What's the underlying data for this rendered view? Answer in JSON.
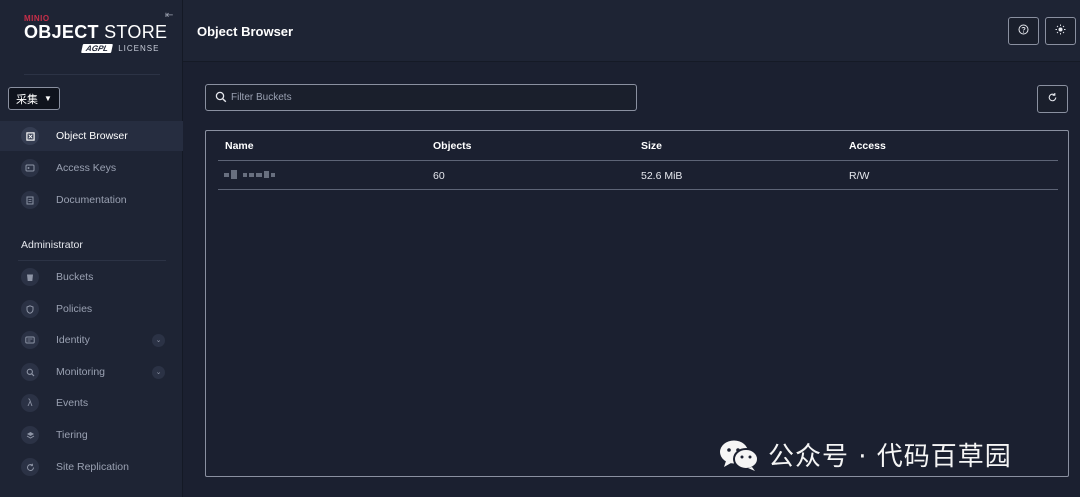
{
  "logo": {
    "brand": "MINIO",
    "title_bold": "OBJECT",
    "title_light": " STORE",
    "badge": "AGPL",
    "license": "LICENSE"
  },
  "workspace_select": {
    "value": "采集"
  },
  "sidebar": {
    "user_items": [
      {
        "label": "Object Browser",
        "icon": "object-browser-icon",
        "active": true
      },
      {
        "label": "Access Keys",
        "icon": "key-icon",
        "active": false
      },
      {
        "label": "Documentation",
        "icon": "document-icon",
        "active": false
      }
    ],
    "admin_title": "Administrator",
    "admin_items": [
      {
        "label": "Buckets",
        "icon": "bucket-icon"
      },
      {
        "label": "Policies",
        "icon": "shield-icon"
      },
      {
        "label": "Identity",
        "icon": "id-card-icon",
        "expandable": true
      },
      {
        "label": "Monitoring",
        "icon": "monitoring-icon",
        "expandable": true
      },
      {
        "label": "Events",
        "icon": "lambda-icon"
      },
      {
        "label": "Tiering",
        "icon": "layers-icon"
      },
      {
        "label": "Site Replication",
        "icon": "replication-icon"
      }
    ]
  },
  "header": {
    "title": "Object Browser"
  },
  "filter": {
    "placeholder": "Filter Buckets"
  },
  "table": {
    "columns": [
      "Name",
      "Objects",
      "Size",
      "Access"
    ],
    "rows": [
      {
        "name": "",
        "objects": "60",
        "size": "52.6 MiB",
        "access": "R/W"
      }
    ]
  },
  "watermark": {
    "text": "公众号 · 代码百草园"
  },
  "colors": {
    "background": "#1b2030",
    "sidebar": "#1e2434",
    "brand_red": "#c72e49",
    "border": "#8a90a0"
  }
}
